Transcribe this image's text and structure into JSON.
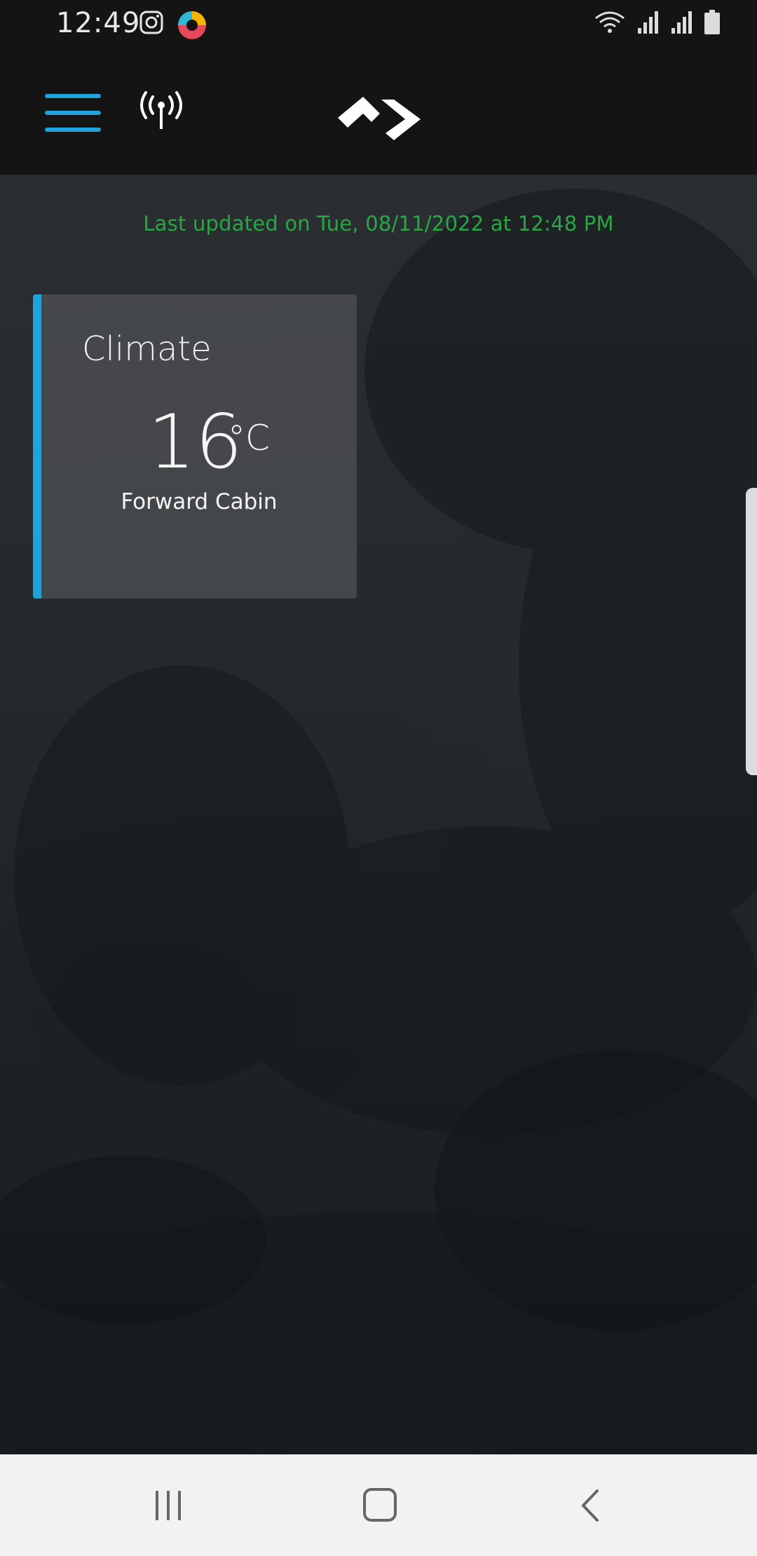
{
  "status_bar": {
    "time": "12:49",
    "left_icons": [
      "instagram-icon",
      "app-notification-icon"
    ],
    "right_icons": [
      "wifi-icon",
      "cell-signal-icon",
      "cell-signal-icon",
      "battery-icon"
    ]
  },
  "header": {
    "menu_icon": "hamburger-menu-icon",
    "signal_icon": "broadcast-antenna-icon",
    "logo_icon": "brand-logo",
    "accent_color": "#1fa3dd"
  },
  "main": {
    "last_updated": "Last updated on Tue, 08/11/2022 at 12:48 PM",
    "last_updated_color": "#28a745"
  },
  "climate_card": {
    "title": "Climate",
    "temperature": "16",
    "unit": "°C",
    "location": "Forward Cabin"
  },
  "nav_bar": {
    "icons": [
      "recent-apps-icon",
      "home-icon",
      "back-icon"
    ]
  }
}
